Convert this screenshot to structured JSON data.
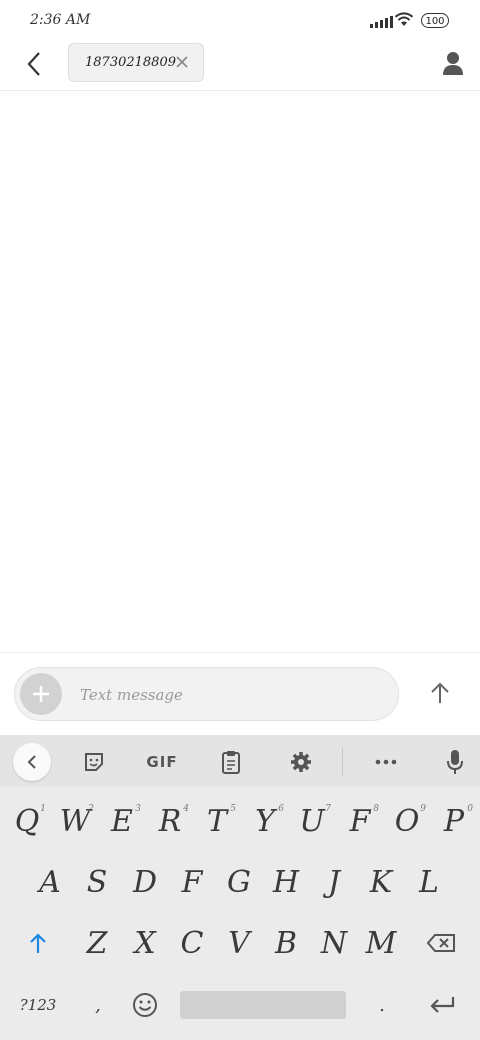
{
  "status_bar": {
    "time": "2:36 AM",
    "battery": "100",
    "icons": [
      "signal-icon",
      "wifi-icon",
      "battery-icon"
    ]
  },
  "header": {
    "recipient": "18730218809",
    "icons": [
      "back-arrow-icon",
      "clear-icon",
      "contact-icon"
    ]
  },
  "compose": {
    "placeholder": "Text message",
    "icons": [
      "add-icon",
      "send-arrow-icon"
    ]
  },
  "keyboard": {
    "toolbar": {
      "gif_label": "GIF",
      "icons": [
        "collapse-icon",
        "sticker-icon",
        "clipboard-icon",
        "settings-icon",
        "more-icon",
        "mic-icon"
      ]
    },
    "row1": [
      {
        "key": "Q",
        "hint": "1"
      },
      {
        "key": "W",
        "hint": "2"
      },
      {
        "key": "E",
        "hint": "3"
      },
      {
        "key": "R",
        "hint": "4"
      },
      {
        "key": "T",
        "hint": "5"
      },
      {
        "key": "Y",
        "hint": "6"
      },
      {
        "key": "U",
        "hint": "7"
      },
      {
        "key": "F",
        "hint": "8"
      },
      {
        "key": "O",
        "hint": "9"
      },
      {
        "key": "P",
        "hint": "0"
      }
    ],
    "row2": [
      "A",
      "S",
      "D",
      "F",
      "G",
      "H",
      "J",
      "K",
      "L"
    ],
    "row3": [
      "Z",
      "X",
      "C",
      "V",
      "B",
      "N",
      "M"
    ],
    "row4": {
      "symbols": "?123",
      "comma": ",",
      "period": "."
    },
    "colors": {
      "shift": "#1e88e5",
      "key_text": "#3a3a3a",
      "background": "#ebebeb"
    }
  }
}
